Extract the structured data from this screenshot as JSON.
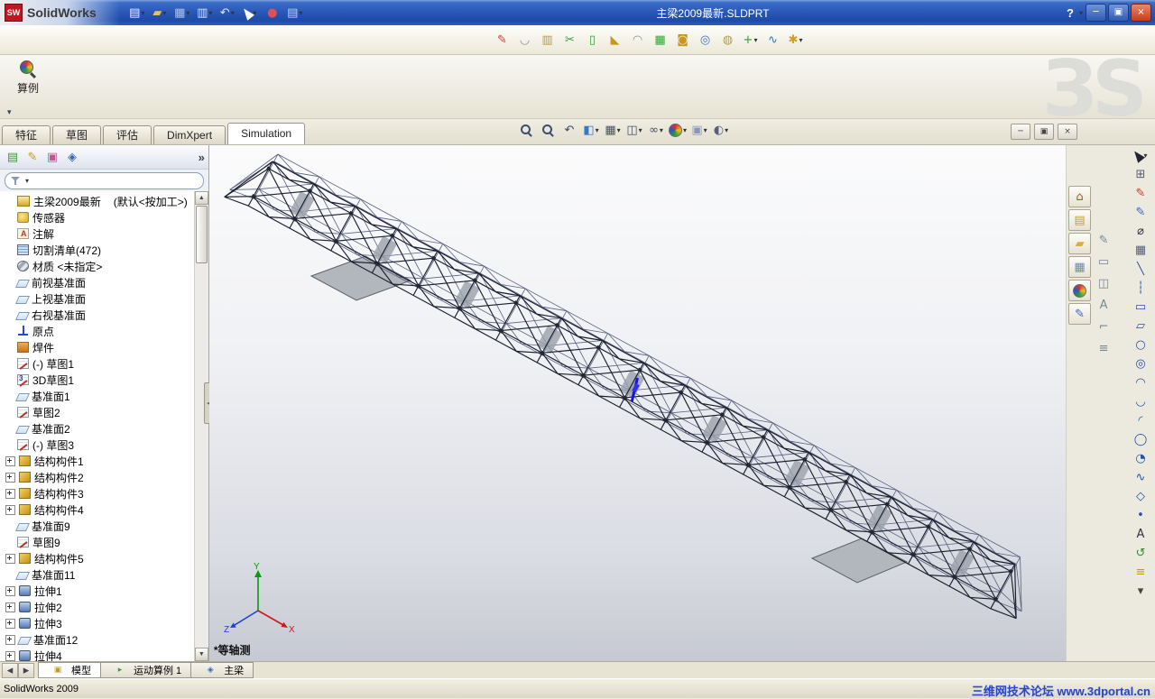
{
  "titlebar": {
    "logo_badge": "SW",
    "logo_text": "SolidWorks",
    "title": "主梁2009最新.SLDPRT",
    "help": "?",
    "icons": [
      {
        "name": "new-document",
        "dd": true
      },
      {
        "name": "open",
        "dd": true
      },
      {
        "name": "save",
        "dd": true
      },
      {
        "name": "print",
        "dd": true
      },
      {
        "name": "undo",
        "dd": true
      },
      {
        "name": "select",
        "dd": true
      },
      {
        "name": "rebuild"
      },
      {
        "name": "options",
        "dd": true
      }
    ],
    "window_buttons": [
      "minimize",
      "restore",
      "close"
    ]
  },
  "toolbar_weldment": {
    "icons": [
      {
        "name": "weld-3d-sketch"
      },
      {
        "name": "weld-bead"
      },
      {
        "name": "structural-member"
      },
      {
        "name": "trim-extend"
      },
      {
        "name": "end-cap"
      },
      {
        "name": "gusset"
      },
      {
        "name": "fillet-bead"
      },
      {
        "name": "extruded-boss"
      },
      {
        "name": "extruded-cut"
      },
      {
        "name": "hole-wizard"
      },
      {
        "name": "revolve-cut"
      },
      {
        "name": "reference-geometry",
        "dd": true
      },
      {
        "name": "curve"
      },
      {
        "name": "instant3d",
        "dd": true
      }
    ]
  },
  "commandmanager": {
    "study_label": "算例"
  },
  "watermark_3ds": "ЗS",
  "tabs": {
    "items": [
      "特征",
      "草图",
      "评估",
      "DimXpert",
      "Simulation"
    ],
    "active": "Simulation"
  },
  "view_toolbar": {
    "icons": [
      {
        "name": "zoom-fit"
      },
      {
        "name": "zoom-area"
      },
      {
        "name": "previous-view"
      },
      {
        "name": "section-view",
        "dd": true
      },
      {
        "name": "view-orientation",
        "dd": true
      },
      {
        "name": "display-style",
        "dd": true
      },
      {
        "name": "hide-show",
        "dd": true
      },
      {
        "name": "appearances",
        "dd": true
      },
      {
        "name": "scene",
        "dd": true
      },
      {
        "name": "view-settings",
        "dd": true
      }
    ]
  },
  "doc_controls": {
    "icons": [
      "doc-minimize",
      "doc-restore",
      "doc-close"
    ]
  },
  "feature_panel": {
    "header_icons": [
      "featuremanager",
      "propertymanager",
      "configurationmanager",
      "dimxpertmanager"
    ],
    "chevron": "»",
    "root": {
      "label": "主梁2009最新",
      "config": "(默认<按加工>)"
    },
    "items": [
      {
        "label": "传感器",
        "icon": "sensor"
      },
      {
        "label": "注解",
        "icon": "annotation"
      },
      {
        "label": "切割清单(472)",
        "icon": "cutlist"
      },
      {
        "label": "材质 <未指定>",
        "icon": "material"
      },
      {
        "label": "前视基准面",
        "icon": "plane"
      },
      {
        "label": "上视基准面",
        "icon": "plane"
      },
      {
        "label": "右视基准面",
        "icon": "plane"
      },
      {
        "label": "原点",
        "icon": "origin"
      },
      {
        "label": "焊件",
        "icon": "weldment"
      },
      {
        "label": "(-) 草图1",
        "icon": "sketch"
      },
      {
        "label": "3D草图1",
        "icon": "sketch3d"
      },
      {
        "label": "基准面1",
        "icon": "plane"
      },
      {
        "label": "草图2",
        "icon": "sketch"
      },
      {
        "label": "基准面2",
        "icon": "plane"
      },
      {
        "label": "(-) 草图3",
        "icon": "sketch"
      },
      {
        "label": "结构构件1",
        "icon": "structmember",
        "expand": true
      },
      {
        "label": "结构构件2",
        "icon": "structmember",
        "expand": true
      },
      {
        "label": "结构构件3",
        "icon": "structmember",
        "expand": true
      },
      {
        "label": "结构构件4",
        "icon": "structmember",
        "expand": true
      },
      {
        "label": "基准面9",
        "icon": "plane"
      },
      {
        "label": "草图9",
        "icon": "sketch"
      },
      {
        "label": "结构构件5",
        "icon": "structmember",
        "expand": true
      },
      {
        "label": "基准面11",
        "icon": "plane"
      },
      {
        "label": "拉伸1",
        "icon": "extrude",
        "expand": true
      },
      {
        "label": "拉伸2",
        "icon": "extrude",
        "expand": true
      },
      {
        "label": "拉伸3",
        "icon": "extrude",
        "expand": true
      },
      {
        "label": "基准面12",
        "icon": "plane",
        "expand": true
      },
      {
        "label": "拉伸4",
        "icon": "extrude",
        "expand": true
      }
    ]
  },
  "viewport": {
    "view_label": "*等轴测",
    "triad": {
      "x": "X",
      "y": "Y",
      "z": "Z"
    }
  },
  "task_pane": {
    "icons": [
      "solidworks-resources",
      "design-library",
      "file-explorer",
      "view-palette",
      "appearances-scenes",
      "custom-properties"
    ]
  },
  "mid_toolbar": {
    "icons": [
      "sketch-display",
      "plane-display",
      "section-display",
      "annotation-display",
      "measure-display",
      "grid-display"
    ]
  },
  "right_toolbar": {
    "icons": [
      {
        "name": "select-tool",
        "dd": true
      },
      {
        "name": "grid-system"
      },
      {
        "name": "sketch-tool"
      },
      {
        "name": "3d-sketch-tool"
      },
      {
        "name": "smart-dimension"
      },
      {
        "name": "sketch-table"
      },
      {
        "name": "line-tool"
      },
      {
        "name": "centerline-tool"
      },
      {
        "name": "rectangle-tool"
      },
      {
        "name": "parallelogram-tool"
      },
      {
        "name": "circle-tool"
      },
      {
        "name": "perimeter-circle-tool"
      },
      {
        "name": "centerpoint-arc-tool"
      },
      {
        "name": "tangent-arc-tool"
      },
      {
        "name": "three-point-arc-tool"
      },
      {
        "name": "ellipse-tool"
      },
      {
        "name": "partial-ellipse-tool"
      },
      {
        "name": "spline-tool"
      },
      {
        "name": "polygon-tool"
      },
      {
        "name": "point-tool"
      },
      {
        "name": "text-tool"
      },
      {
        "name": "convert-entities-tool"
      },
      {
        "name": "offset-entities-tool"
      },
      {
        "name": "more-tools"
      }
    ]
  },
  "bottom_bar": {
    "nav": [
      "tabs-scroll-left",
      "tabs-scroll-right"
    ],
    "tabs": [
      {
        "label": "模型",
        "icon": "model-tab",
        "active": true
      },
      {
        "label": "运动算例 1",
        "icon": "motion-tab",
        "active": false
      },
      {
        "label": "主梁",
        "icon": "simulation-tab",
        "active": false
      }
    ]
  },
  "status_bar": {
    "left": "SolidWorks 2009",
    "watermark": "三维网技术论坛 www.3dportal.cn"
  }
}
